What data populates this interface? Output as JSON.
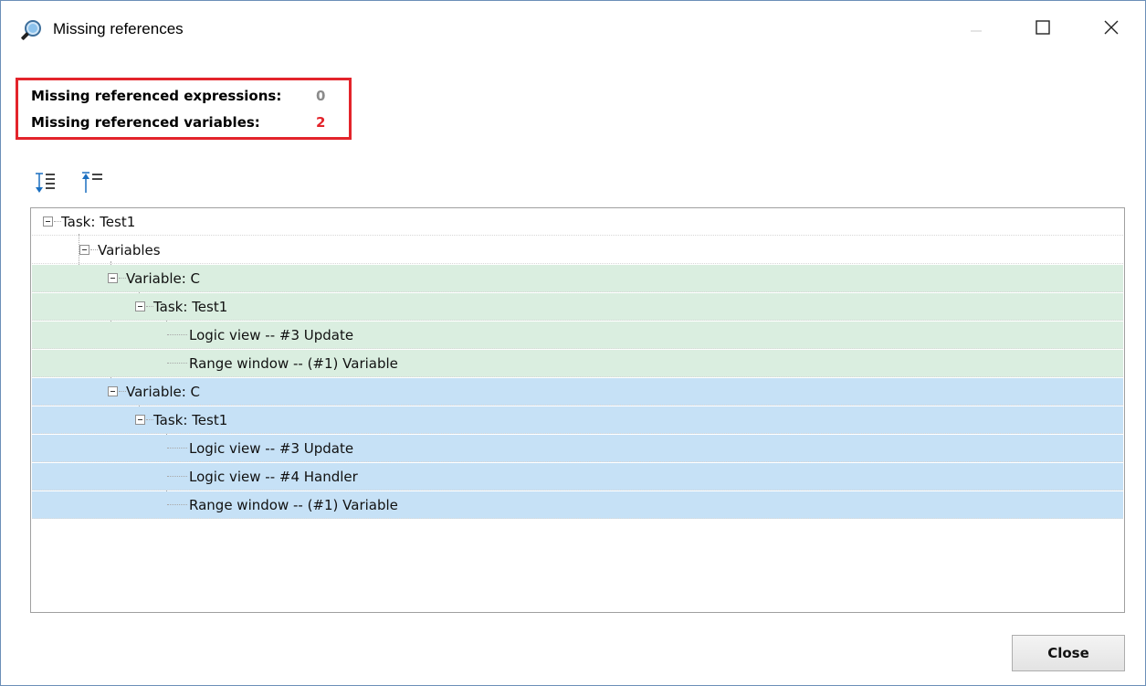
{
  "window": {
    "title": "Missing references",
    "controls": {
      "minimize_icon": "minimize-icon",
      "maximize_icon": "maximize-icon",
      "close_icon": "close-icon"
    }
  },
  "summary": {
    "expressions_label": "Missing referenced expressions:",
    "expressions_count": "0",
    "variables_label": "Missing referenced variables:",
    "variables_count": "2",
    "highlight_color": "#e3242b"
  },
  "toolbar": {
    "expand_all_icon": "expand-all-icon",
    "collapse_all_icon": "collapse-all-icon"
  },
  "tree": {
    "nodes": [
      {
        "label": "Task: Test1",
        "level": 0,
        "expander": "collapse",
        "highlight": "none"
      },
      {
        "label": "Variables",
        "level": 1,
        "expander": "collapse",
        "highlight": "none"
      },
      {
        "label": "Variable: C",
        "level": 2,
        "expander": "collapse",
        "highlight": "green"
      },
      {
        "label": "Task: Test1",
        "level": 3,
        "expander": "collapse",
        "highlight": "green"
      },
      {
        "label": "Logic view -- #3 Update",
        "level": 4,
        "expander": "none",
        "highlight": "green"
      },
      {
        "label": "Range window -- (#1) Variable",
        "level": 4,
        "expander": "none",
        "highlight": "green"
      },
      {
        "label": "Variable: C",
        "level": 2,
        "expander": "collapse",
        "highlight": "blue"
      },
      {
        "label": "Task: Test1",
        "level": 3,
        "expander": "collapse",
        "highlight": "blue"
      },
      {
        "label": "Logic view -- #3 Update",
        "level": 4,
        "expander": "none",
        "highlight": "blue"
      },
      {
        "label": "Logic view -- #4 Handler",
        "level": 4,
        "expander": "none",
        "highlight": "blue"
      },
      {
        "label": "Range window -- (#1) Variable",
        "level": 4,
        "expander": "none",
        "highlight": "blue"
      }
    ],
    "colors": {
      "green": "#daeee0",
      "blue": "#c6e1f6"
    }
  },
  "footer": {
    "close_label": "Close"
  }
}
